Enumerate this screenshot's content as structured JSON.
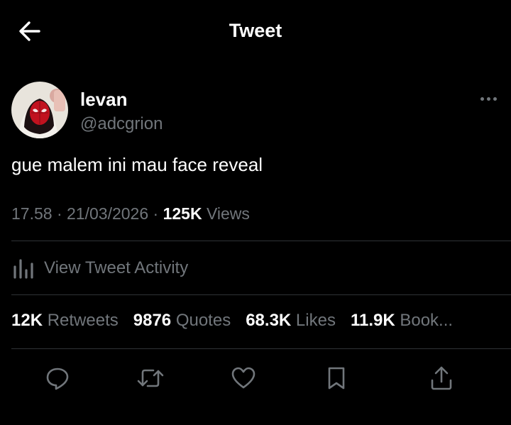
{
  "header": {
    "title": "Tweet"
  },
  "author": {
    "name": "levan",
    "handle": "@adcgrion"
  },
  "tweet": {
    "text": "gue malem ini mau face reveal"
  },
  "meta": {
    "time": "17.58",
    "separator": " · ",
    "date": "21/03/2026",
    "views_count": "125K",
    "views_label": "Views"
  },
  "activity": {
    "label": "View Tweet Activity"
  },
  "stats": [
    {
      "count": "12K",
      "label": "Retweets"
    },
    {
      "count": "9876",
      "label": "Quotes"
    },
    {
      "count": "68.3K",
      "label": "Likes"
    },
    {
      "count": "11.9K",
      "label": "Book..."
    }
  ],
  "icons": {
    "back": "arrow-left-icon",
    "more": "more-horizontal-icon",
    "activity": "bar-chart-icon",
    "reply": "reply-icon",
    "retweet": "retweet-icon",
    "like": "heart-icon",
    "bookmark": "bookmark-icon",
    "share": "share-icon"
  },
  "colors": {
    "background": "#000000",
    "text": "#ffffff",
    "secondary": "#71767b",
    "divider": "#2f3336"
  }
}
